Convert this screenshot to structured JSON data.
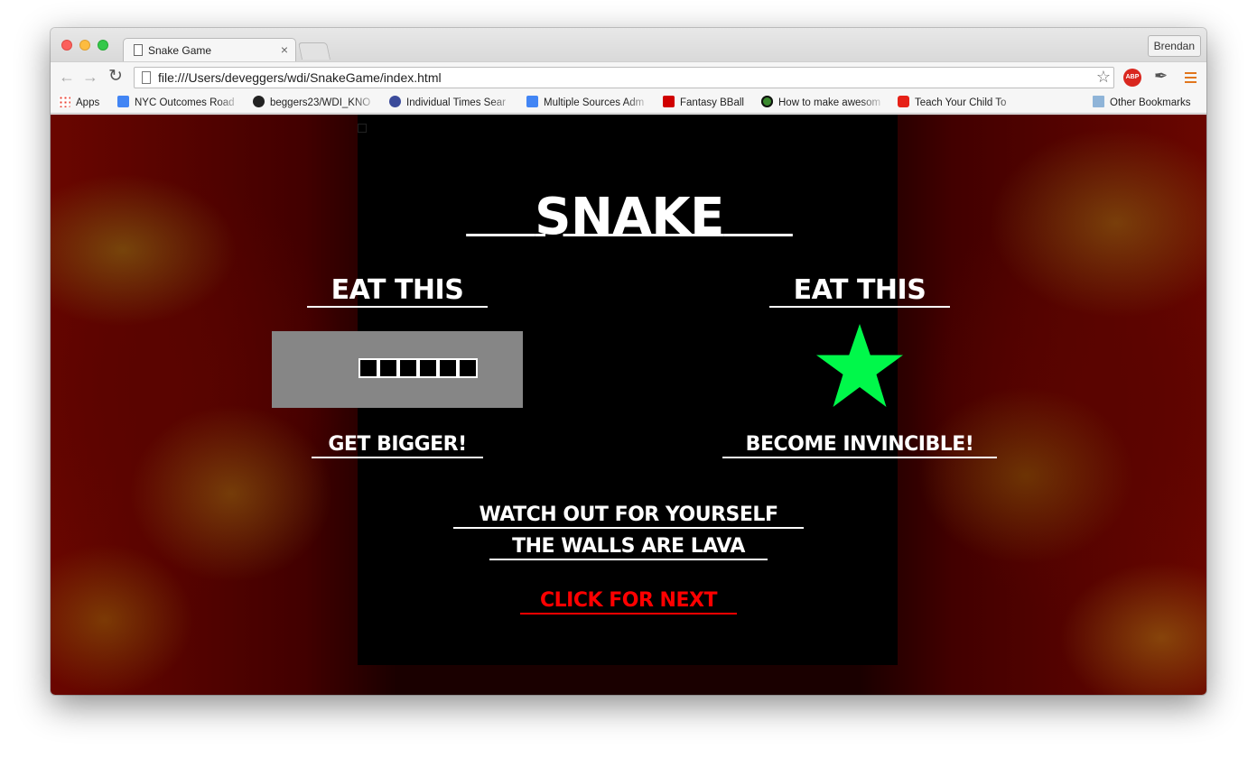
{
  "browser": {
    "tab_title": "Snake Game",
    "tab_close": "×",
    "profile_name": "Brendan",
    "url": "file:///Users/deveggers/wdi/SnakeGame/index.html",
    "abp_label": "ABP",
    "bookmarks": [
      {
        "label": "Apps",
        "icon": "apps-grid-icon",
        "color": "#4285f4"
      },
      {
        "label": "NYC Outcomes Road",
        "icon": "google-doc-icon",
        "color": "#4285f4"
      },
      {
        "label": "beggers23/WDI_KNO",
        "icon": "github-icon",
        "color": "#222222"
      },
      {
        "label": "Individual Times Sear",
        "icon": "usa-swimming-icon",
        "color": "#3b4b9b"
      },
      {
        "label": "Multiple Sources Adm",
        "icon": "google-doc-icon",
        "color": "#4285f4"
      },
      {
        "label": "Fantasy BBall",
        "icon": "espn-icon",
        "color": "#d00000"
      },
      {
        "label": "How to make awesom",
        "icon": "green-circle-icon",
        "color": "#3a8a2e"
      },
      {
        "label": "Teach Your Child To",
        "icon": "youtube-icon",
        "color": "#e62117"
      }
    ],
    "other_bookmarks": "Other Bookmarks"
  },
  "game": {
    "title": "SNAKE",
    "food_heading": "EAT THIS",
    "food_caption": "GET BIGGER!",
    "star_heading": "EAT THIS",
    "star_caption": "BECOME INVINCIBLE!",
    "warning_1": "WATCH OUT FOR YOURSELF",
    "warning_2": "THE WALLS ARE LAVA",
    "next_label": "CLICK FOR NEXT",
    "star_color": "#00f84a",
    "next_color": "#ff0000",
    "snake_segments": 6
  }
}
